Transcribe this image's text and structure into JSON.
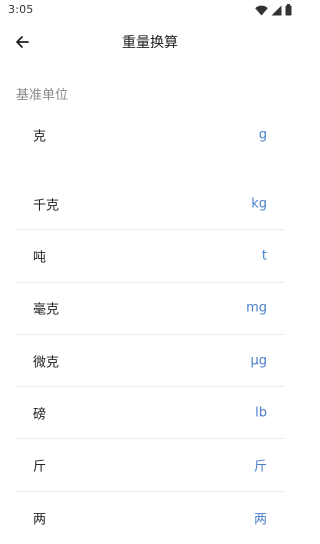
{
  "status_bar": {
    "time": "3:05",
    "icons": [
      "wifi-icon",
      "cellular-signal-icon",
      "battery-icon"
    ]
  },
  "app_bar": {
    "back_icon": "arrow-left-icon",
    "title": "重量换算"
  },
  "base_section": {
    "label": "基准单位",
    "unit": {
      "name": "克",
      "symbol": "g"
    }
  },
  "units": [
    {
      "name": "千克",
      "symbol": "kg"
    },
    {
      "name": "吨",
      "symbol": "t"
    },
    {
      "name": "毫克",
      "symbol": "mg"
    },
    {
      "name": "微克",
      "symbol": "μg"
    },
    {
      "name": "磅",
      "symbol": "lb"
    },
    {
      "name": "斤",
      "symbol": "斤"
    },
    {
      "name": "两",
      "symbol": "两"
    }
  ],
  "colors": {
    "symbol": "#4a7fc8",
    "section_label": "#8a8a8a",
    "divider": "#ececec"
  }
}
